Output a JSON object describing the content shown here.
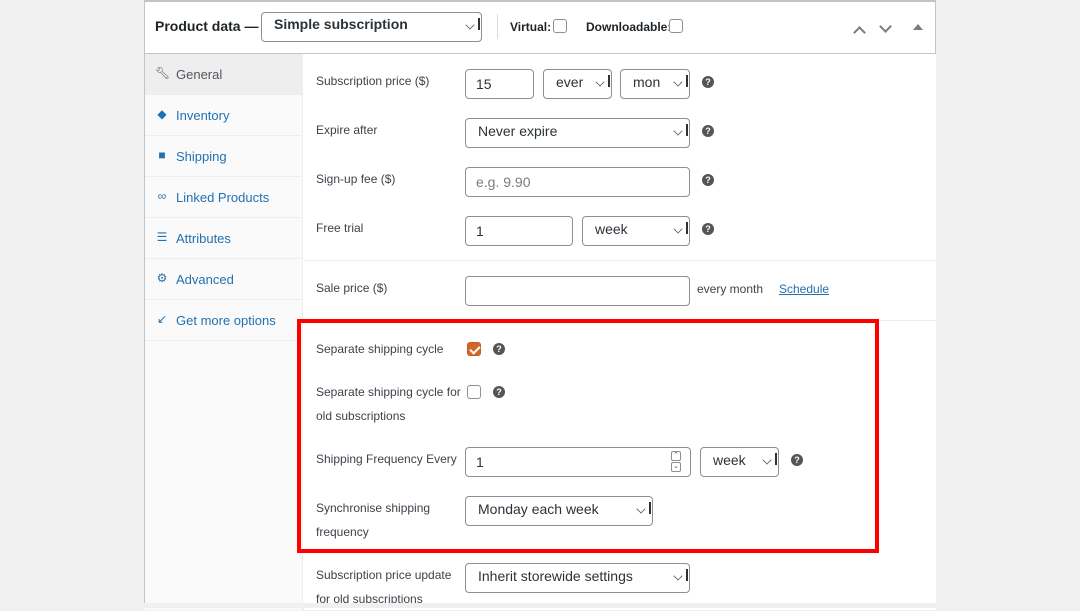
{
  "header": {
    "title": "Product data —",
    "product_type": "Simple subscription",
    "virtual_label": "Virtual:",
    "virtual_checked": false,
    "downloadable_label": "Downloadable:",
    "downloadable_checked": false,
    "icons": [
      "chevron-up-icon",
      "chevron-down-icon",
      "collapse-triangle-icon"
    ]
  },
  "sidebar": {
    "items": [
      {
        "label": "General",
        "icon": "wrench-icon",
        "active": true
      },
      {
        "label": "Inventory",
        "icon": "tag-icon",
        "active": false
      },
      {
        "label": "Shipping",
        "icon": "truck-icon",
        "active": false
      },
      {
        "label": "Linked Products",
        "icon": "link-icon",
        "active": false
      },
      {
        "label": "Attributes",
        "icon": "list-icon",
        "active": false
      },
      {
        "label": "Advanced",
        "icon": "gear-icon",
        "active": false
      },
      {
        "label": "Get more options",
        "icon": "plugin-icon",
        "active": false
      }
    ]
  },
  "general": {
    "subscription_price": {
      "label": "Subscription price ($)",
      "value": "15",
      "interval": "ever",
      "period": "mon"
    },
    "expire_after": {
      "label": "Expire after",
      "value": "Never expire"
    },
    "signup_fee": {
      "label": "Sign-up fee ($)",
      "placeholder": "e.g. 9.90",
      "value": ""
    },
    "free_trial": {
      "label": "Free trial",
      "value": "1",
      "period": "week"
    },
    "sale_price": {
      "label": "Sale price ($)",
      "value": "",
      "suffix": "every month",
      "schedule_link": "Schedule"
    },
    "separate_shipping_cycle": {
      "label": "Separate shipping cycle",
      "checked": true
    },
    "separate_shipping_old": {
      "label_line1": "Separate shipping cycle for",
      "label_line2": "old subscriptions",
      "checked": false
    },
    "shipping_frequency": {
      "label": "Shipping Frequency Every",
      "value": "1",
      "period": "week"
    },
    "sync_shipping": {
      "label_line1": "Synchronise shipping",
      "label_line2": "frequency",
      "value": "Monday each week"
    },
    "price_update_old": {
      "label_line1": "Subscription price update",
      "label_line2": "for old subscriptions",
      "value": "Inherit storewide settings"
    }
  },
  "help_glyph": "?",
  "colors": {
    "accent": "#2271b1",
    "checkbox_checked": "#d4662b",
    "highlight": "#ff0000"
  }
}
